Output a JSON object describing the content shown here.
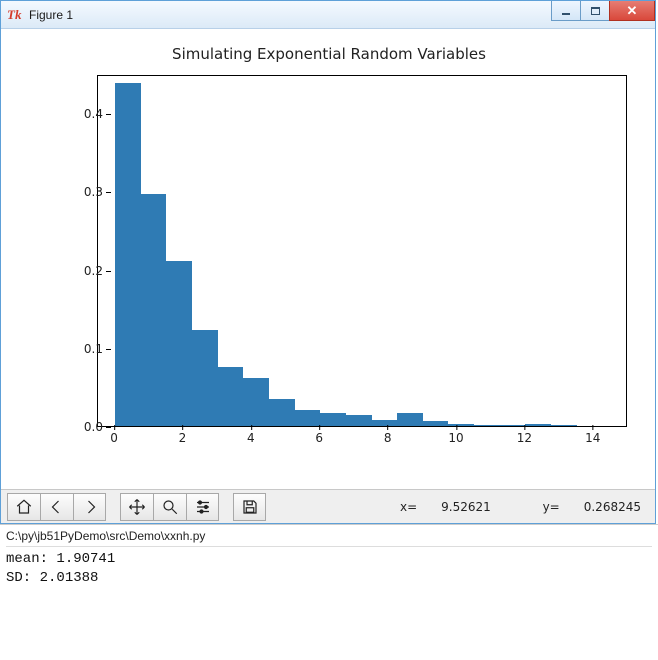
{
  "window": {
    "title": "Figure 1"
  },
  "chart_data": {
    "type": "bar",
    "title": "Simulating Exponential Random Variables",
    "xlim": [
      -0.5,
      15
    ],
    "ylim": [
      0,
      0.45
    ],
    "xticks": [
      0,
      2,
      4,
      6,
      8,
      10,
      12,
      14
    ],
    "yticks": [
      0.0,
      0.1,
      0.2,
      0.3,
      0.4
    ],
    "bin_edges": [
      0,
      0.75,
      1.5,
      2.25,
      3,
      3.75,
      4.5,
      5.25,
      6,
      6.75,
      7.5,
      8.25,
      9,
      9.75,
      10.5,
      11.25,
      12,
      12.75,
      13.5,
      14.25
    ],
    "values": [
      0.438,
      0.297,
      0.211,
      0.123,
      0.075,
      0.061,
      0.035,
      0.021,
      0.017,
      0.014,
      0.008,
      0.017,
      0.006,
      0.002,
      0.001,
      0.001,
      0.002,
      0.001,
      0.0
    ]
  },
  "toolbar": {
    "coord_x_label": "x=",
    "coord_x": "9.52621",
    "coord_y_label": "y=",
    "coord_y": "0.268245"
  },
  "console": {
    "script_path": "C:\\py\\jb51PyDemo\\src\\Demo\\xxnh.py",
    "mean_label": "mean: ",
    "mean_value": "1.90741",
    "sd_label": "SD: ",
    "sd_value": "2.01388"
  }
}
